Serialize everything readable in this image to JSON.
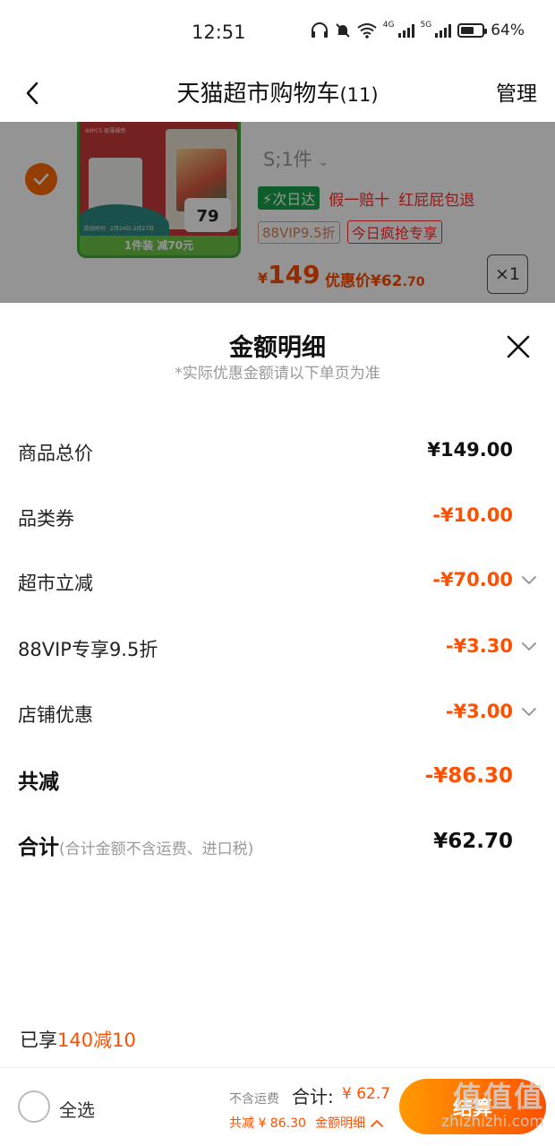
{
  "status_bar": {
    "time": "12:51",
    "battery": "64%",
    "battery_level": 0.64,
    "net_4g": "4G",
    "net_5g": "5G",
    "icons": [
      "headphones-icon",
      "mute-icon",
      "wifi-icon",
      "signal-4g-icon",
      "signal-5g-icon",
      "battery-icon"
    ]
  },
  "nav": {
    "title": "天猫超市购物车",
    "count": "(11)",
    "manage": "管理"
  },
  "cart_item": {
    "spec": "S;1件",
    "tag_fast": "次日达",
    "tag_fake": "假一赔十",
    "tag_free_ship": "红屁屁包退",
    "tag_vip": "88VIP9.5折",
    "tag_hot": "今日疯抢专享",
    "price_symbol": "¥",
    "price": "149",
    "discount_label": "优惠价¥62",
    "discount_cents": ".70",
    "qty": "×1",
    "image_bottom_text": "1件装 减70元",
    "image_price": "79",
    "image_note": "88PCS 极薄裸感",
    "image_date": "活动时间：2月24日-2月27日"
  },
  "sheet": {
    "title": "金额明细",
    "subtitle": "*实际优惠金额请以下单页为准",
    "rows": [
      {
        "label": "商品总价",
        "value": "¥149.00"
      },
      {
        "label": "品类券",
        "value": "-¥10.00"
      },
      {
        "label": "超市立减",
        "value": "-¥70.00"
      },
      {
        "label": "88VIP专享9.5折",
        "value": "-¥3.30"
      },
      {
        "label": "店铺优惠",
        "value": "-¥3.00"
      }
    ],
    "total_reduce_label": "共减",
    "total_reduce_value": "-¥86.30",
    "sum_label": "合计",
    "sum_note": "(合计金额不含运费、进口税)",
    "sum_value": "¥62.70",
    "enjoy_prefix": "已享",
    "enjoy_promo": "140减10"
  },
  "bottom_bar": {
    "select_all": "全选",
    "fee_note": "不含运费",
    "total_label": "合计:",
    "total_value": "¥ 62.7",
    "reduce": "共减 ¥ 86.30",
    "detail": "金额明细",
    "checkout": "结算",
    "watermark_logo": "值值值",
    "watermark_url": "zhizhizhi.com"
  },
  "colors": {
    "accent": "#ff5000",
    "checkbox": "#ff6a00",
    "green_tag": "#19a34a",
    "red_tag": "#ff2a2a"
  }
}
